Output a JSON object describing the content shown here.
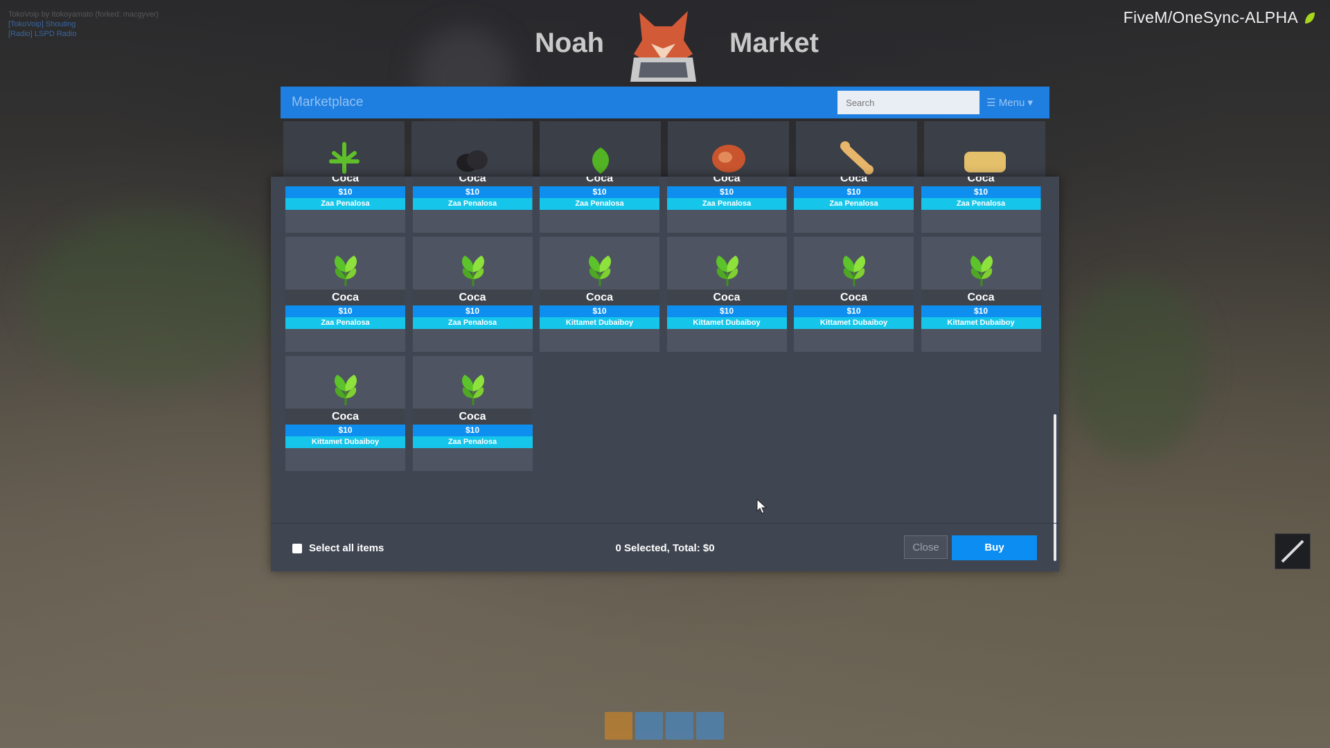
{
  "debug": {
    "line1": "TokoVoip by Itokoyamato (forked: macgyver)",
    "line2": "[TokoVoip] Shouting",
    "line3": "[Radio] LSPD Radio"
  },
  "server_label": "FiveM/OneSync-ALPHA",
  "title": {
    "left": "Noah",
    "right": "Market"
  },
  "marketplace": {
    "title": "Marketplace",
    "search_placeholder": "Search",
    "menu_label": "☰ Menu ▾"
  },
  "items": [
    {
      "name": "Coca",
      "price": "$10",
      "seller": "Zaa Penalosa"
    },
    {
      "name": "Coca",
      "price": "$10",
      "seller": "Zaa Penalosa"
    },
    {
      "name": "Coca",
      "price": "$10",
      "seller": "Zaa Penalosa"
    },
    {
      "name": "Coca",
      "price": "$10",
      "seller": "Zaa Penalosa"
    },
    {
      "name": "Coca",
      "price": "$10",
      "seller": "Zaa Penalosa"
    },
    {
      "name": "Coca",
      "price": "$10",
      "seller": "Zaa Penalosa"
    },
    {
      "name": "Coca",
      "price": "$10",
      "seller": "Zaa Penalosa"
    },
    {
      "name": "Coca",
      "price": "$10",
      "seller": "Zaa Penalosa"
    },
    {
      "name": "Coca",
      "price": "$10",
      "seller": "Kittamet Dubaiboy"
    },
    {
      "name": "Coca",
      "price": "$10",
      "seller": "Kittamet Dubaiboy"
    },
    {
      "name": "Coca",
      "price": "$10",
      "seller": "Kittamet Dubaiboy"
    },
    {
      "name": "Coca",
      "price": "$10",
      "seller": "Kittamet Dubaiboy"
    },
    {
      "name": "Coca",
      "price": "$10",
      "seller": "Kittamet Dubaiboy"
    },
    {
      "name": "Coca",
      "price": "$10",
      "seller": "Zaa Penalosa"
    }
  ],
  "thumb_icons": [
    "cannabis-leaf-icon",
    "coal-icon",
    "green-leaf-icon",
    "meat-icon",
    "bone-icon",
    "gold-bar-icon"
  ],
  "footer": {
    "select_all_label": "Select all items",
    "summary": "0 Selected, Total: $0",
    "close_label": "Close",
    "buy_label": "Buy"
  },
  "colors": {
    "accent": "#1e7fe0",
    "price_bar": "#0e8ff0",
    "seller_bar": "#16c5ea",
    "panel": "#3f4551"
  }
}
